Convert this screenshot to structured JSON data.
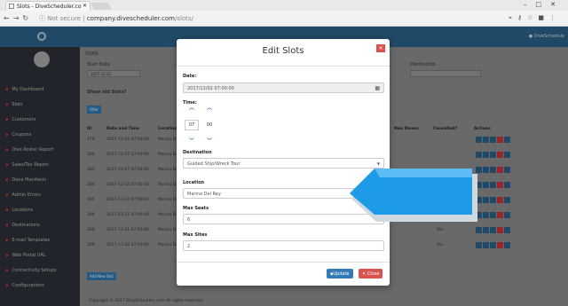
{
  "browser": {
    "tab_title": "Slots - DiveScheduler.co",
    "security": "Not secure",
    "url_host": "company.divescheduler.com",
    "url_path": "/slots/"
  },
  "header": {
    "user": "DiveSchedule"
  },
  "sidebar": {
    "items": [
      {
        "label": "My Dashboard"
      },
      {
        "label": "Slots"
      },
      {
        "label": "Customers"
      },
      {
        "label": "Coupons"
      },
      {
        "label": "Dive Roster Report"
      },
      {
        "label": "Sales/Tax Report"
      },
      {
        "label": "Done Manifests"
      },
      {
        "label": "Admin Errors"
      },
      {
        "label": "Locations"
      },
      {
        "label": "Destinations"
      },
      {
        "label": "E-mail Templates"
      },
      {
        "label": "Web Portal URL"
      },
      {
        "label": "Connectivity Setups"
      },
      {
        "label": "Configurations"
      }
    ]
  },
  "main": {
    "title": "Slots",
    "start_date_label": "Start Date",
    "start_date_value": "2017-12-01",
    "destination_label": "Destination",
    "show_old_label": "Show old Slots?",
    "filter_button": "Filter",
    "add_button": "Add New Slot",
    "columns": [
      "ID",
      "Date and Time",
      "Location",
      "Non Divers",
      "Cancelled?",
      "Actions"
    ],
    "rows": [
      {
        "id": "279",
        "datetime": "2017-12-02 07:00:00",
        "location": "Marina Del",
        "non_divers": "",
        "cancelled": ""
      },
      {
        "id": "280",
        "datetime": "2017-12-07 07:00:00",
        "location": "Marina Del",
        "non_divers": "",
        "cancelled": ""
      },
      {
        "id": "283",
        "datetime": "2017-12-07 07:00:00",
        "location": "Marina Del",
        "non_divers": "",
        "cancelled": ""
      },
      {
        "id": "284",
        "datetime": "2017-12-14 07:00:00",
        "location": "Marina Del",
        "non_divers": "",
        "cancelled": ""
      },
      {
        "id": "285",
        "datetime": "2017-12-14 07:00:00",
        "location": "Marina Del",
        "non_divers": "",
        "cancelled": ""
      },
      {
        "id": "286",
        "datetime": "2017-12-21 07:00:00",
        "location": "Marina Del",
        "non_divers": "",
        "cancelled": "Yes"
      },
      {
        "id": "288",
        "datetime": "2017-12-21 07:00:00",
        "location": "Marina Del",
        "non_divers": "",
        "cancelled": "Yes"
      },
      {
        "id": "289",
        "datetime": "2017-12-28 07:00:00",
        "location": "Marina Del",
        "non_divers": "",
        "cancelled": "Yes"
      }
    ],
    "footer": "Copyright © 2017 DiveScheduler.com All rights reserved."
  },
  "modal": {
    "title": "Edit Slots",
    "date_label": "Date:",
    "date_value": "2017/12/02 07:00:00",
    "time_label": "Time:",
    "hour": "07",
    "minute": "00",
    "destination_label": "Destination",
    "destination_value": "Guided Ship/Wreck Tour",
    "location_label": "Location",
    "location_value": "Marina Del Rey",
    "max_seats_label": "Max Seats",
    "max_seats_value": "6",
    "max_sites_label": "Max Sites",
    "max_sites_value": "2",
    "update_button": "Update",
    "close_button": "Close"
  },
  "colors": {
    "accent": "#2a6288",
    "danger": "#d9534f",
    "pointer": "#1e9be6"
  }
}
